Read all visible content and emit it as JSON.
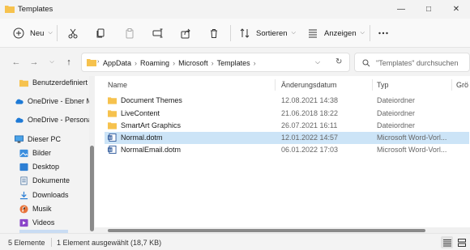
{
  "window": {
    "title": "Templates",
    "controls": [
      "minimize-icon",
      "maximize-icon",
      "close-icon"
    ]
  },
  "toolbar": {
    "new_label": "Neu",
    "sort_label": "Sortieren",
    "view_label": "Anzeigen",
    "icons": [
      "cut-icon",
      "copy-icon",
      "paste-icon",
      "rename-icon",
      "share-icon",
      "delete-icon"
    ],
    "more_icon": "more-icon"
  },
  "address": {
    "breadcrumbs": [
      "AppData",
      "Roaming",
      "Microsoft",
      "Templates"
    ],
    "search_placeholder": "\"Templates\" durchsuchen"
  },
  "sidebar": {
    "items": [
      {
        "label": "Benutzerdefiniert",
        "icon": "folder-icon"
      },
      {
        "label": "OneDrive - Ebner M",
        "icon": "cloud-icon"
      },
      {
        "label": "OneDrive - Persona",
        "icon": "cloud-icon"
      },
      {
        "label": "Dieser PC",
        "icon": "pc-icon"
      },
      {
        "label": "Bilder",
        "icon": "pictures-icon"
      },
      {
        "label": "Desktop",
        "icon": "desktop-icon"
      },
      {
        "label": "Dokumente",
        "icon": "documents-icon"
      },
      {
        "label": "Downloads",
        "icon": "downloads-icon"
      },
      {
        "label": "Musik",
        "icon": "music-icon"
      },
      {
        "label": "Videos",
        "icon": "videos-icon"
      }
    ]
  },
  "files": {
    "columns": {
      "name": "Name",
      "date": "Änderungsdatum",
      "type": "Typ",
      "size": "Grö"
    },
    "rows": [
      {
        "name": "Document Themes",
        "date": "12.08.2021 14:38",
        "type": "Dateiordner",
        "icon": "folder-icon",
        "selected": false
      },
      {
        "name": "LiveContent",
        "date": "21.06.2018 18:22",
        "type": "Dateiordner",
        "icon": "folder-icon",
        "selected": false
      },
      {
        "name": "SmartArt Graphics",
        "date": "26.07.2021 16:11",
        "type": "Dateiordner",
        "icon": "folder-icon",
        "selected": false
      },
      {
        "name": "Normal.dotm",
        "date": "12.01.2022 14:57",
        "type": "Microsoft Word-Vorl...",
        "icon": "word-template-icon",
        "selected": true
      },
      {
        "name": "NormalEmail.dotm",
        "date": "06.01.2022 17:03",
        "type": "Microsoft Word-Vorl...",
        "icon": "word-template-icon",
        "selected": false
      }
    ]
  },
  "status": {
    "count": "5 Elemente",
    "selection": "1 Element ausgewählt (18,7 KB)"
  },
  "colors": {
    "selection": "#cce4f7",
    "folder": "#f6c24e",
    "word": "#2b579a"
  }
}
